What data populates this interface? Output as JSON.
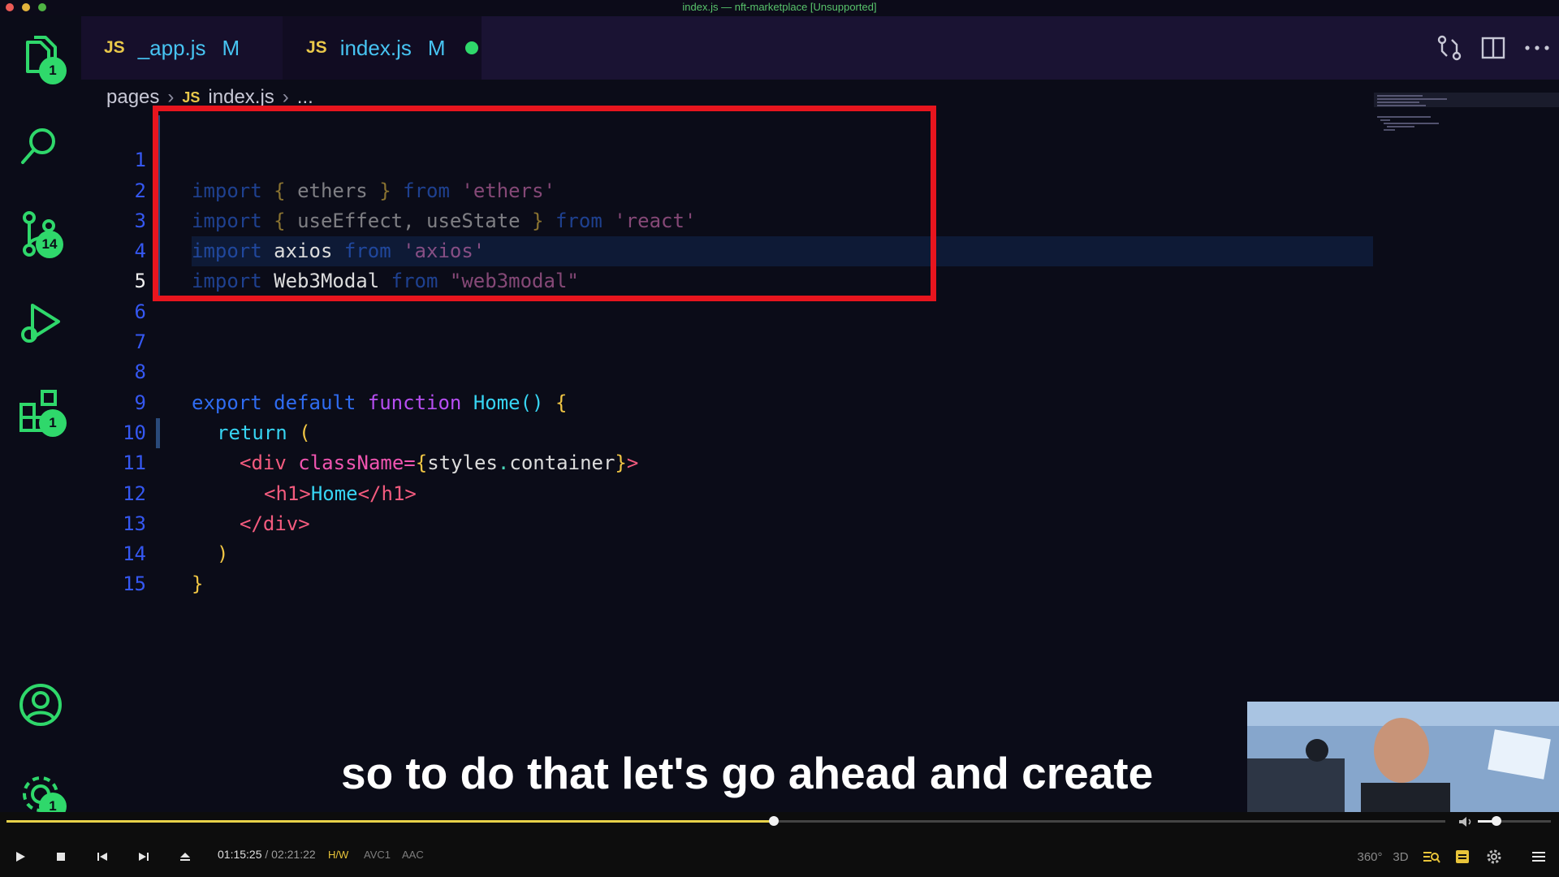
{
  "window": {
    "title": "index.js — nft-marketplace [Unsupported]"
  },
  "activity_bar": {
    "items": [
      {
        "name": "explorer",
        "badge": "1"
      },
      {
        "name": "search"
      },
      {
        "name": "source-control",
        "badge": "14"
      },
      {
        "name": "run-and-debug"
      },
      {
        "name": "extensions",
        "badge": "1"
      },
      {
        "name": "accounts"
      },
      {
        "name": "manage",
        "badge": "1"
      }
    ]
  },
  "tabs": [
    {
      "lang": "JS",
      "label": "_app.js",
      "status": "M"
    },
    {
      "lang": "JS",
      "label": "index.js",
      "status": "M",
      "unsaved": true
    }
  ],
  "breadcrumb": {
    "folder": "pages",
    "lang": "JS",
    "file": "index.js",
    "more": "..."
  },
  "editor": {
    "line_numbers": [
      "1",
      "2",
      "3",
      "4",
      "5",
      "6",
      "7",
      "8",
      "9",
      "10",
      "11",
      "12",
      "13",
      "14",
      "15"
    ],
    "active_line": "5",
    "code": {
      "l1": {
        "import": "import",
        "ob": "{",
        "ident": "ethers",
        "cb": "}",
        "from": "from",
        "str": "'ethers'"
      },
      "l2": {
        "import": "import",
        "ob": "{",
        "ident1": "useEffect,",
        "ident2": "useState",
        "cb": "}",
        "from": "from",
        "str": "'react'"
      },
      "l3": {
        "import": "import",
        "ident": "axios",
        "from": "from",
        "str": "'axios'"
      },
      "l4": {
        "import": "import",
        "ident": "Web3Modal",
        "from": "from",
        "str": "\"web3modal\""
      },
      "l8": {
        "export": "export",
        "default": "default",
        "function": "function",
        "name": "Home",
        "parens": "()",
        "brace": "{"
      },
      "l9": {
        "return": "return",
        "paren": "("
      },
      "l10": {
        "open": "<",
        "tag": "div",
        "attr": "className=",
        "ob": "{",
        "obj": "styles",
        "dot": ".",
        "prop": "container",
        "cb": "}",
        "close": ">"
      },
      "l11": {
        "open": "<",
        "tag": "h1",
        "gt": ">",
        "text": "Home",
        "close_open": "</",
        "close_tag": "h1",
        "close_gt": ">"
      },
      "l12": {
        "open": "</",
        "tag": "div",
        "close": ">"
      },
      "l13": {
        "paren": ")"
      },
      "l14": {
        "brace": "}"
      }
    }
  },
  "caption": "so to do that let's go ahead and create",
  "player": {
    "current_time": "01:15:25",
    "separator": "/",
    "total_time": "02:21:22",
    "progress": 0.5335,
    "volume": 0.25,
    "chips": [
      "H/W",
      "AVC1",
      "AAC"
    ],
    "right_controls": [
      "360°",
      "3D"
    ]
  },
  "colors": {
    "accent_badge": "#2fd86b",
    "highlight_box": "#e8151e",
    "tab_bar": "#1a1333",
    "editor_bg": "#0b0c18",
    "seek_fill": "#e8d24a"
  }
}
